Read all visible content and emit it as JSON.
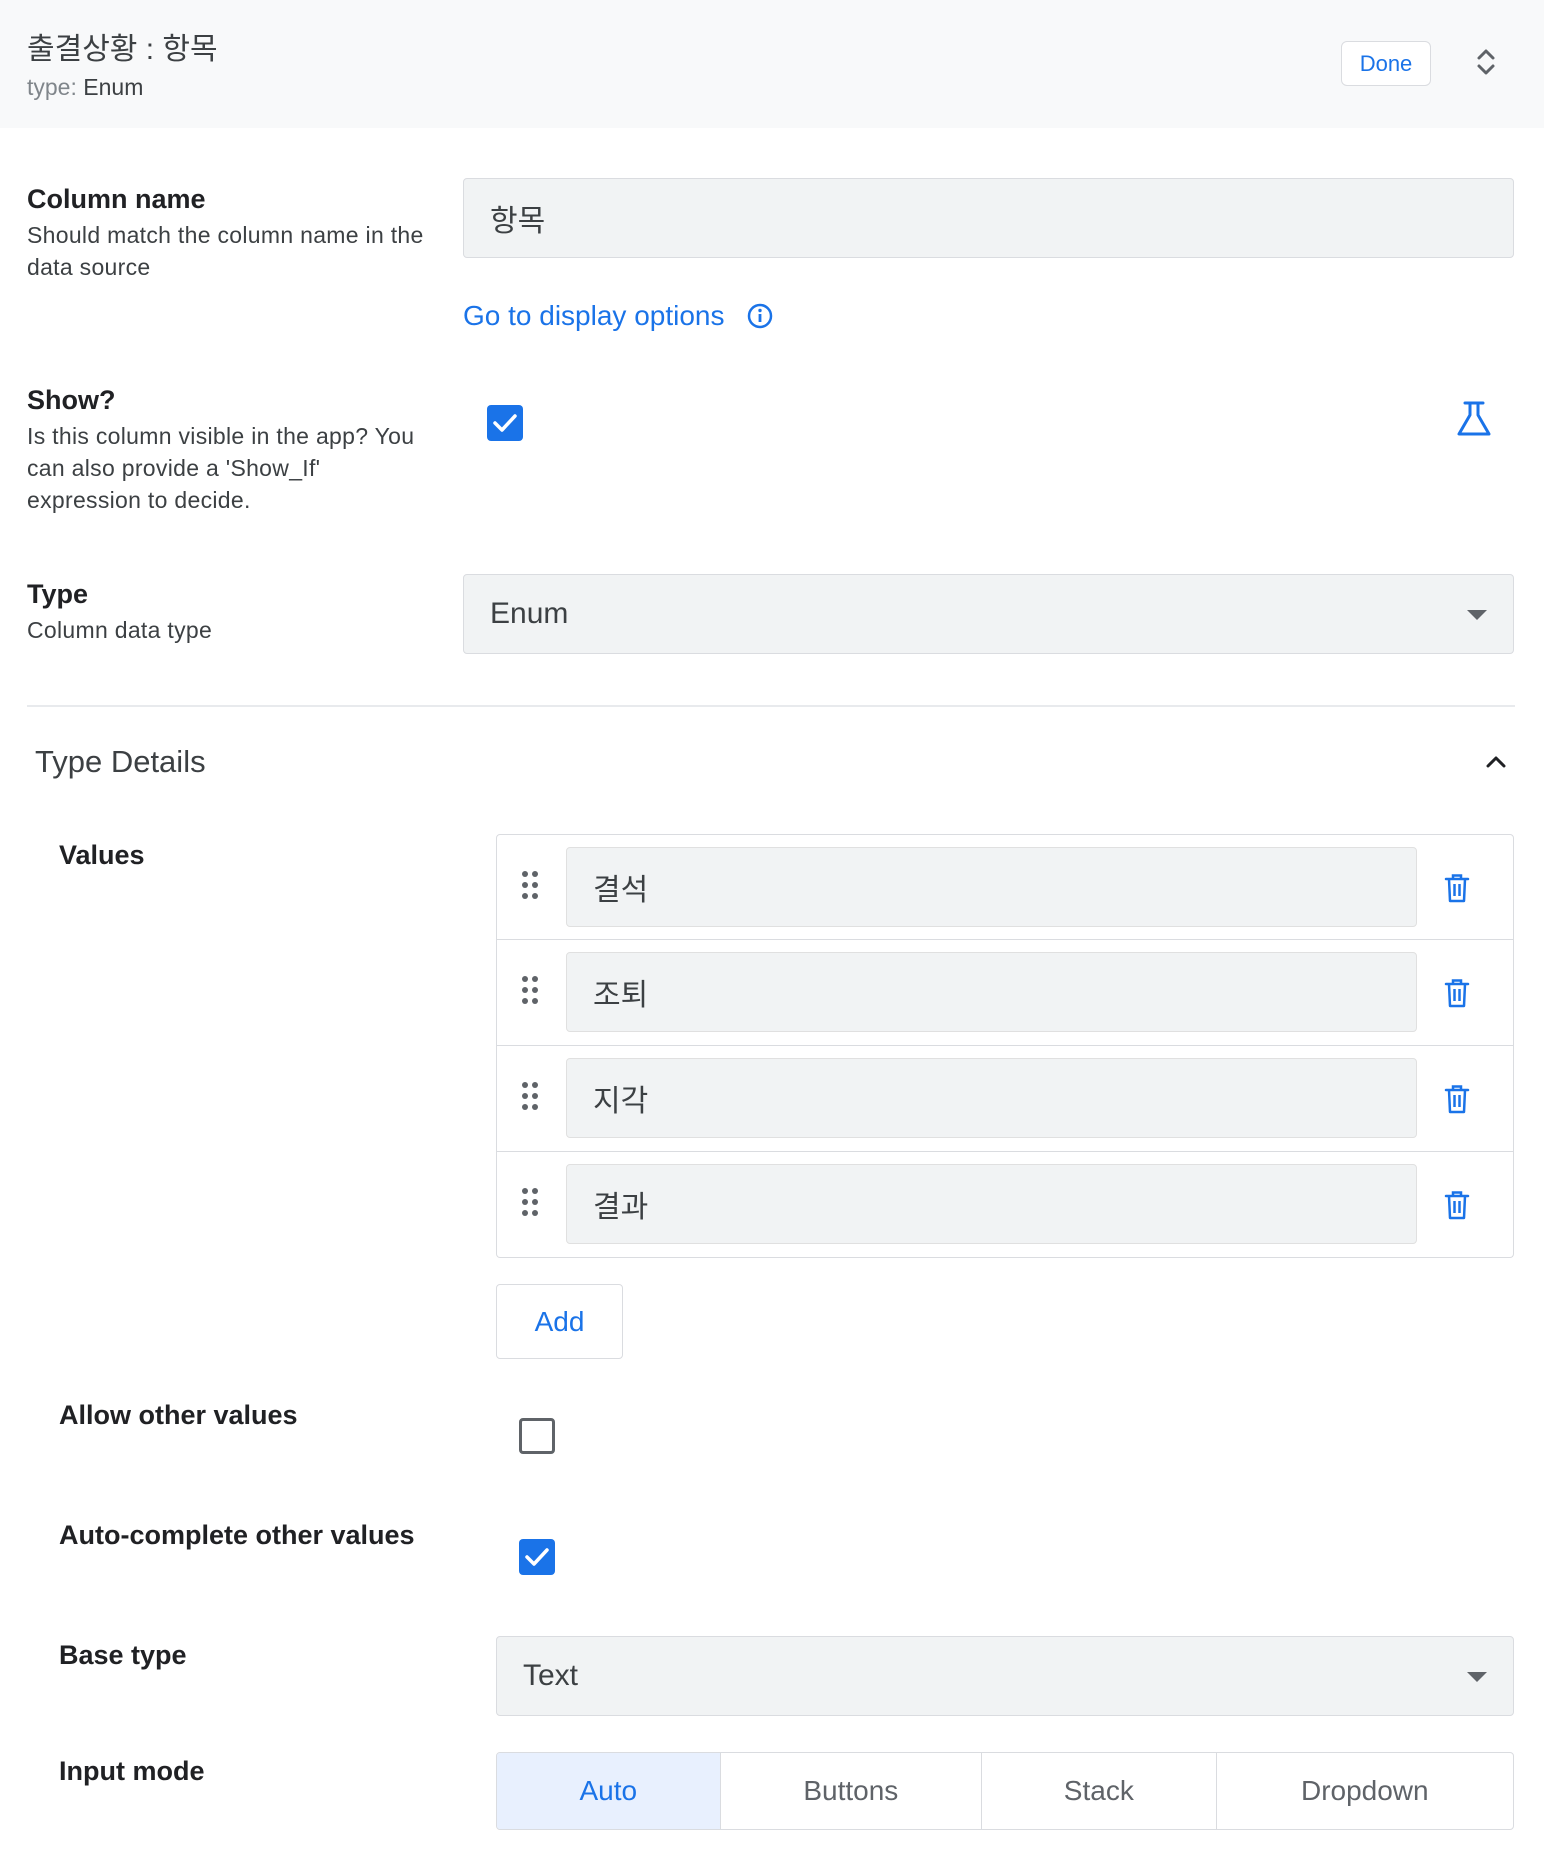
{
  "header": {
    "title": "출결상황 : 항목",
    "type_prefix": "type:",
    "type_value": "Enum",
    "done_label": "Done"
  },
  "column_name": {
    "label": "Column name",
    "description": "Should match the column name in the data source",
    "value": "항목",
    "display_link": "Go to display options"
  },
  "show": {
    "label": "Show?",
    "description": "Is this column visible in the app? You can also provide a 'Show_If' expression to decide.",
    "checked": true
  },
  "type": {
    "label": "Type",
    "description": "Column data type",
    "value": "Enum"
  },
  "type_details": {
    "title": "Type Details",
    "values_label": "Values",
    "values": [
      "결석",
      "조퇴",
      "지각",
      "결과"
    ],
    "add_label": "Add",
    "allow_other_label": "Allow other values",
    "allow_other_checked": false,
    "autocomplete_label": "Auto-complete other values",
    "autocomplete_checked": true,
    "base_type_label": "Base type",
    "base_type_value": "Text",
    "input_mode_label": "Input mode",
    "input_modes": [
      "Auto",
      "Buttons",
      "Stack",
      "Dropdown"
    ],
    "input_mode_selected": "Auto"
  },
  "colors": {
    "accent": "#1a73e8",
    "field_bg": "#f1f3f4",
    "header_bg": "#f8f9fa",
    "active_segment_bg": "#e8f0fe"
  },
  "icons": [
    "chevron-up-down-icon",
    "info-icon",
    "flask-icon",
    "chevron-up-icon",
    "drag-handle-icon",
    "trash-icon",
    "checkmark-icon",
    "dropdown-caret-icon"
  ]
}
